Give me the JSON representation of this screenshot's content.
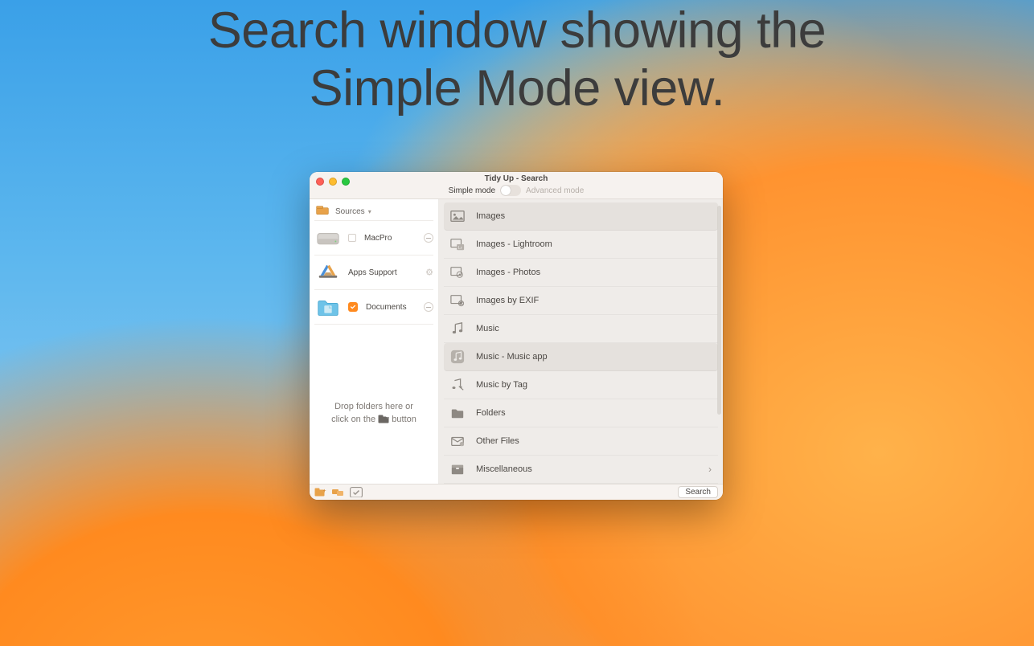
{
  "headline": {
    "line1": "Search window showing the",
    "line2": "Simple Mode view."
  },
  "window": {
    "title": "Tidy Up - Search",
    "mode": {
      "simple": "Simple mode",
      "advanced": "Advanced mode",
      "value": "simple"
    },
    "sidebar": {
      "header": "Sources",
      "items": [
        {
          "label": "MacPro",
          "kind": "disk",
          "checked": false
        },
        {
          "label": "Apps Support",
          "kind": "apps",
          "settings": true
        },
        {
          "label": "Documents",
          "kind": "folder",
          "checked": true
        }
      ],
      "drop_hint": {
        "line1": "Drop folders here or",
        "line2_a": "click on the ",
        "line2_b": " button"
      }
    },
    "categories": [
      {
        "label": "Images",
        "icon": "image",
        "selected": true
      },
      {
        "label": "Images - Lightroom",
        "icon": "image-lr"
      },
      {
        "label": "Images - Photos",
        "icon": "image-photos"
      },
      {
        "label": "Images by EXIF",
        "icon": "image-exif"
      },
      {
        "label": "Music",
        "icon": "music"
      },
      {
        "label": "Music - Music app",
        "icon": "music-app",
        "selected": true
      },
      {
        "label": "Music by Tag",
        "icon": "music-tag"
      },
      {
        "label": "Folders",
        "icon": "folder"
      },
      {
        "label": "Other Files",
        "icon": "mail"
      },
      {
        "label": "Miscellaneous",
        "icon": "box",
        "disclosure": true
      }
    ],
    "footer": {
      "search": "Search"
    }
  }
}
